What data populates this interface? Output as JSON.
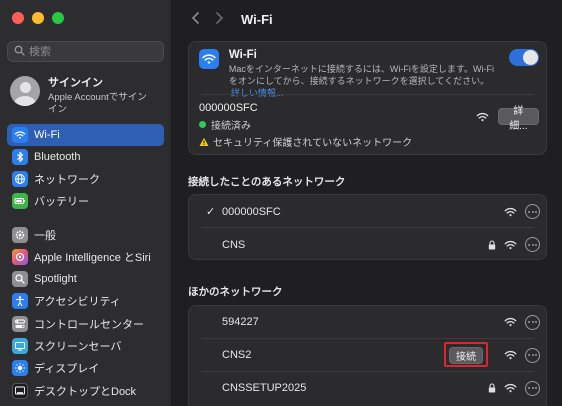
{
  "window": {
    "title": "Wi-Fi"
  },
  "search": {
    "placeholder": "検索"
  },
  "account": {
    "name": "サインイン",
    "subtitle": "Apple Accountでサインイン"
  },
  "sidebar": {
    "items": [
      {
        "label": "Wi-Fi",
        "icon": "wifi-icon",
        "color": "#2a7ef0",
        "active": true
      },
      {
        "label": "Bluetooth",
        "icon": "bluetooth-icon",
        "color": "#2a7ef0"
      },
      {
        "label": "ネットワーク",
        "icon": "globe-icon",
        "color": "#2a7ef0"
      },
      {
        "label": "バッテリー",
        "icon": "battery-icon",
        "color": "#3bb54a"
      },
      {
        "label": "一般",
        "icon": "gear-icon",
        "color": "#8e8e93"
      },
      {
        "label": "Apple Intelligence とSiri",
        "icon": "siri-icon",
        "color": "#e0567c"
      },
      {
        "label": "Spotlight",
        "icon": "magnifier-icon",
        "color": "#8e8e93"
      },
      {
        "label": "アクセシビリティ",
        "icon": "accessibility-icon",
        "color": "#2a7ef0"
      },
      {
        "label": "コントロールセンター",
        "icon": "toggles-icon",
        "color": "#8e8e93"
      },
      {
        "label": "スクリーンセーバ",
        "icon": "screensaver-icon",
        "color": "#39a7e0"
      },
      {
        "label": "ディスプレイ",
        "icon": "sun-icon",
        "color": "#2a7ef0"
      },
      {
        "label": "デスクトップとDock",
        "icon": "dock-icon",
        "color": "#1c1c1e"
      }
    ]
  },
  "wifi_card": {
    "title": "Wi-Fi",
    "description": "Macをインターネットに接続するには、Wi-Fiを設定します。Wi-Fiをオンにしてから、接続するネットワークを選択してください。",
    "more_info": "詳しい情報...",
    "toggle_on": true,
    "current_network": "000000SFC",
    "status": "接続済み",
    "warning": "セキュリティ保護されていないネットワーク",
    "details_label": "詳細...",
    "status_color": "#34c759"
  },
  "known_networks": {
    "title": "接続したことのあるネットワーク",
    "items": [
      {
        "name": "000000SFC",
        "checked": true,
        "locked": false
      },
      {
        "name": "CNS",
        "checked": false,
        "locked": true
      }
    ]
  },
  "other_networks": {
    "title": "ほかのネットワーク",
    "connect_label": "接続",
    "items": [
      {
        "name": "594227",
        "locked": false
      },
      {
        "name": "CNS2",
        "locked": false,
        "connect": true
      },
      {
        "name": "CNSSETUP2025",
        "locked": true
      }
    ]
  }
}
